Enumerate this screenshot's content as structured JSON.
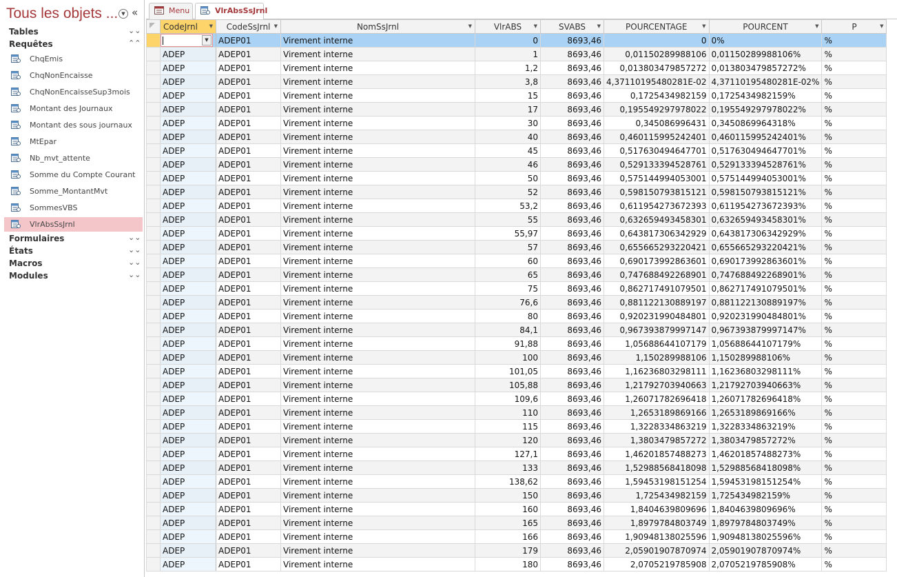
{
  "nav": {
    "title": "Tous les objets ...",
    "groups": [
      {
        "label": "Tables",
        "state": "collapsed"
      },
      {
        "label": "Requêtes",
        "state": "expanded"
      },
      {
        "label": "Formulaires",
        "state": "collapsed"
      },
      {
        "label": "États",
        "state": "collapsed"
      },
      {
        "label": "Macros",
        "state": "collapsed"
      },
      {
        "label": "Modules",
        "state": "collapsed"
      }
    ],
    "queries": [
      {
        "label": "ChqEmis"
      },
      {
        "label": "ChqNonEncaisse"
      },
      {
        "label": "ChqNonEncaisseSup3mois"
      },
      {
        "label": "Montant des Journaux"
      },
      {
        "label": "Montant des sous journaux"
      },
      {
        "label": "MtEpar"
      },
      {
        "label": "Nb_mvt_attente"
      },
      {
        "label": "Somme du Compte Courant"
      },
      {
        "label": "Somme_MontantMvt"
      },
      {
        "label": "SommesVBS"
      },
      {
        "label": "VlrAbsSsJrnl",
        "selected": true
      }
    ]
  },
  "tabs": [
    {
      "label": "Menu",
      "active": false
    },
    {
      "label": "VlrAbsSsJrnl",
      "active": true
    }
  ],
  "grid": {
    "columns": [
      "CodeJrnl",
      "CodeSsJrnl",
      "NomSsJrnl",
      "VlrABS",
      "SVABS",
      "POURCENTAGE",
      "POURCENT",
      "P"
    ],
    "rows": [
      [
        "",
        "ADEP01",
        "Virement interne",
        "0",
        "8693,46",
        "0",
        "0%",
        "%"
      ],
      [
        "ADEP",
        "ADEP01",
        "Virement interne",
        "1",
        "8693,46",
        "0,01150289988106",
        "0,01150289988106%",
        "%"
      ],
      [
        "ADEP",
        "ADEP01",
        "Virement interne",
        "1,2",
        "8693,46",
        "0,013803479857272",
        "0,013803479857272%",
        "%"
      ],
      [
        "ADEP",
        "ADEP01",
        "Virement interne",
        "3,8",
        "8693,46",
        "4,37110195480281E-02",
        "4,37110195480281E-02%",
        "%"
      ],
      [
        "ADEP",
        "ADEP01",
        "Virement interne",
        "15",
        "8693,46",
        "0,1725434982159",
        "0,1725434982159%",
        "%"
      ],
      [
        "ADEP",
        "ADEP01",
        "Virement interne",
        "17",
        "8693,46",
        "0,195549297978022",
        "0,195549297978022%",
        "%"
      ],
      [
        "ADEP",
        "ADEP01",
        "Virement interne",
        "30",
        "8693,46",
        "0,345086996431",
        "0,3450869964318%",
        "%"
      ],
      [
        "ADEP",
        "ADEP01",
        "Virement interne",
        "40",
        "8693,46",
        "0,460115995242401",
        "0,460115995242401%",
        "%"
      ],
      [
        "ADEP",
        "ADEP01",
        "Virement interne",
        "45",
        "8693,46",
        "0,517630494647701",
        "0,517630494647701%",
        "%"
      ],
      [
        "ADEP",
        "ADEP01",
        "Virement interne",
        "46",
        "8693,46",
        "0,529133394528761",
        "0,529133394528761%",
        "%"
      ],
      [
        "ADEP",
        "ADEP01",
        "Virement interne",
        "50",
        "8693,46",
        "0,575144994053001",
        "0,575144994053001%",
        "%"
      ],
      [
        "ADEP",
        "ADEP01",
        "Virement interne",
        "52",
        "8693,46",
        "0,598150793815121",
        "0,598150793815121%",
        "%"
      ],
      [
        "ADEP",
        "ADEP01",
        "Virement interne",
        "53,2",
        "8693,46",
        "0,611954273672393",
        "0,611954273672393%",
        "%"
      ],
      [
        "ADEP",
        "ADEP01",
        "Virement interne",
        "55",
        "8693,46",
        "0,632659493458301",
        "0,632659493458301%",
        "%"
      ],
      [
        "ADEP",
        "ADEP01",
        "Virement interne",
        "55,97",
        "8693,46",
        "0,643817306342929",
        "0,643817306342929%",
        "%"
      ],
      [
        "ADEP",
        "ADEP01",
        "Virement interne",
        "57",
        "8693,46",
        "0,655665293220421",
        "0,655665293220421%",
        "%"
      ],
      [
        "ADEP",
        "ADEP01",
        "Virement interne",
        "60",
        "8693,46",
        "0,690173992863601",
        "0,690173992863601%",
        "%"
      ],
      [
        "ADEP",
        "ADEP01",
        "Virement interne",
        "65",
        "8693,46",
        "0,747688492268901",
        "0,747688492268901%",
        "%"
      ],
      [
        "ADEP",
        "ADEP01",
        "Virement interne",
        "75",
        "8693,46",
        "0,862717491079501",
        "0,862717491079501%",
        "%"
      ],
      [
        "ADEP",
        "ADEP01",
        "Virement interne",
        "76,6",
        "8693,46",
        "0,881122130889197",
        "0,881122130889197%",
        "%"
      ],
      [
        "ADEP",
        "ADEP01",
        "Virement interne",
        "80",
        "8693,46",
        "0,920231990484801",
        "0,920231990484801%",
        "%"
      ],
      [
        "ADEP",
        "ADEP01",
        "Virement interne",
        "84,1",
        "8693,46",
        "0,967393879997147",
        "0,967393879997147%",
        "%"
      ],
      [
        "ADEP",
        "ADEP01",
        "Virement interne",
        "91,88",
        "8693,46",
        "1,05688644107179",
        "1,05688644107179%",
        "%"
      ],
      [
        "ADEP",
        "ADEP01",
        "Virement interne",
        "100",
        "8693,46",
        "1,150289988106",
        "1,150289988106%",
        "%"
      ],
      [
        "ADEP",
        "ADEP01",
        "Virement interne",
        "101,05",
        "8693,46",
        "1,16236803298111",
        "1,16236803298111%",
        "%"
      ],
      [
        "ADEP",
        "ADEP01",
        "Virement interne",
        "105,88",
        "8693,46",
        "1,21792703940663",
        "1,21792703940663%",
        "%"
      ],
      [
        "ADEP",
        "ADEP01",
        "Virement interne",
        "109,6",
        "8693,46",
        "1,26071782696418",
        "1,26071782696418%",
        "%"
      ],
      [
        "ADEP",
        "ADEP01",
        "Virement interne",
        "110",
        "8693,46",
        "1,2653189869166",
        "1,2653189869166%",
        "%"
      ],
      [
        "ADEP",
        "ADEP01",
        "Virement interne",
        "115",
        "8693,46",
        "1,3228334863219",
        "1,3228334863219%",
        "%"
      ],
      [
        "ADEP",
        "ADEP01",
        "Virement interne",
        "120",
        "8693,46",
        "1,3803479857272",
        "1,3803479857272%",
        "%"
      ],
      [
        "ADEP",
        "ADEP01",
        "Virement interne",
        "127,1",
        "8693,46",
        "1,46201857488273",
        "1,46201857488273%",
        "%"
      ],
      [
        "ADEP",
        "ADEP01",
        "Virement interne",
        "133",
        "8693,46",
        "1,52988568418098",
        "1,52988568418098%",
        "%"
      ],
      [
        "ADEP",
        "ADEP01",
        "Virement interne",
        "138,62",
        "8693,46",
        "1,59453198151254",
        "1,59453198151254%",
        "%"
      ],
      [
        "ADEP",
        "ADEP01",
        "Virement interne",
        "150",
        "8693,46",
        "1,725434982159",
        "1,725434982159%",
        "%"
      ],
      [
        "ADEP",
        "ADEP01",
        "Virement interne",
        "160",
        "8693,46",
        "1,8404639809696",
        "1,8404639809696%",
        "%"
      ],
      [
        "ADEP",
        "ADEP01",
        "Virement interne",
        "165",
        "8693,46",
        "1,8979784803749",
        "1,8979784803749%",
        "%"
      ],
      [
        "ADEP",
        "ADEP01",
        "Virement interne",
        "166",
        "8693,46",
        "1,90948138025596",
        "1,90948138025596%",
        "%"
      ],
      [
        "ADEP",
        "ADEP01",
        "Virement interne",
        "179",
        "8693,46",
        "2,05901907870974",
        "2,05901907870974%",
        "%"
      ],
      [
        "ADEP",
        "ADEP01",
        "Virement interne",
        "180",
        "8693,46",
        "2,0705219785908",
        "2,0705219785908%",
        "%"
      ]
    ]
  }
}
